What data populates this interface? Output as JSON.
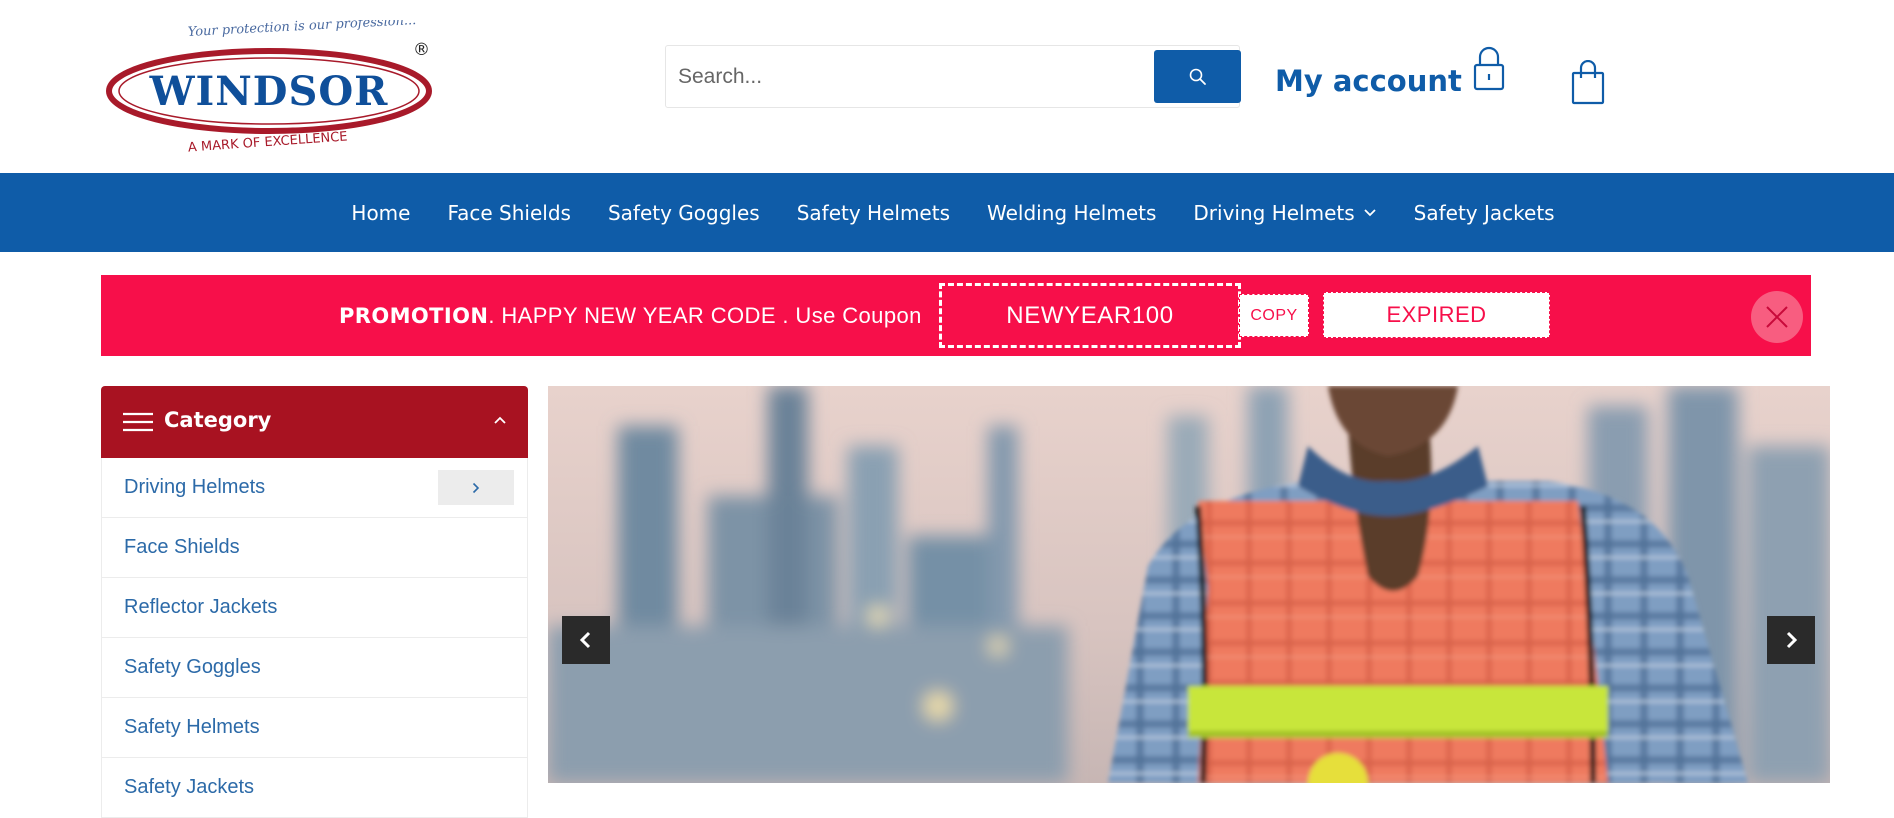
{
  "header": {
    "logo": {
      "tagline": "Your protection is our profession...",
      "brand": "WINDSOR",
      "registered": "®",
      "subtitle": "A MARK OF EXCELLENCE"
    },
    "search": {
      "placeholder": "Search..."
    },
    "account_label": "My account"
  },
  "nav": {
    "items": [
      {
        "label": "Home"
      },
      {
        "label": "Face Shields"
      },
      {
        "label": "Safety Goggles"
      },
      {
        "label": "Safety Helmets"
      },
      {
        "label": "Welding Helmets"
      },
      {
        "label": "Driving Helmets"
      },
      {
        "label": "Safety Jackets"
      }
    ]
  },
  "promo": {
    "title": "PROMOTION",
    "text": ". HAPPY NEW YEAR CODE . Use Coupon",
    "code": "NEWYEAR100",
    "copy_label": "COPY",
    "status_label": "EXPIRED"
  },
  "category": {
    "title": "Category",
    "items": [
      {
        "label": "Driving Helmets"
      },
      {
        "label": "Face Shields"
      },
      {
        "label": "Reflector Jackets"
      },
      {
        "label": "Safety Goggles"
      },
      {
        "label": "Safety Helmets"
      },
      {
        "label": "Safety Jackets"
      }
    ]
  },
  "colors": {
    "brand_blue": "#0f5ca8",
    "promo_red": "#f70f4a",
    "category_red": "#a81221",
    "link_blue": "#2c6aa8"
  },
  "icons": {
    "search": "search-icon",
    "account": "lock-icon",
    "cart": "shopping-bag-icon",
    "close": "close-icon",
    "menu": "hamburger-icon"
  }
}
